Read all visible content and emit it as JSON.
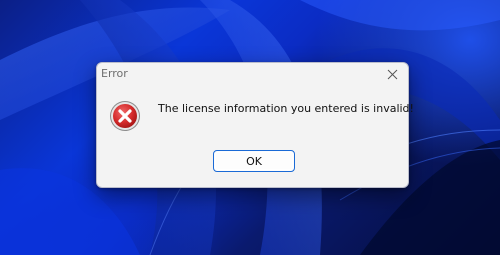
{
  "dialog": {
    "title": "Error",
    "message": "The license information you entered is invalid!",
    "ok_label": "OK",
    "icon": "error-icon",
    "close_icon": "close-icon"
  },
  "colors": {
    "accent": "#1a6ad6",
    "error_red": "#d42a2a",
    "wallpaper_blue": "#0a36d8"
  }
}
